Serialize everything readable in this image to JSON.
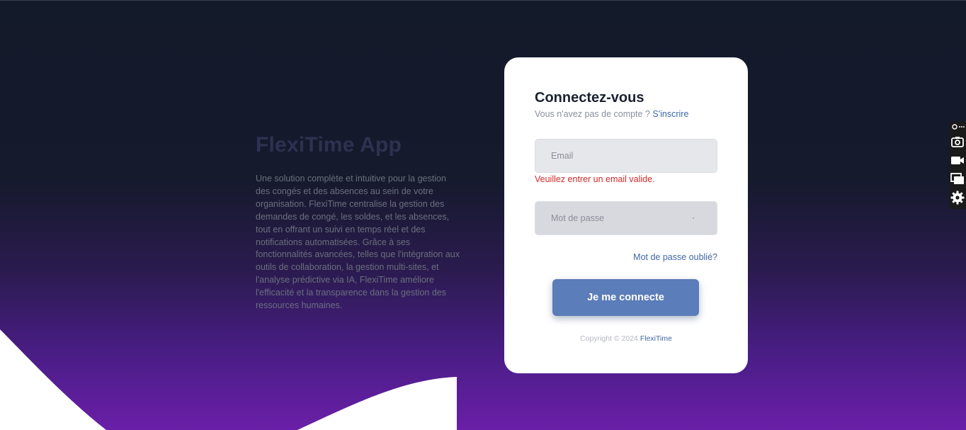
{
  "hero": {
    "title": "FlexiTime App",
    "description": "Une solution complète et intuitive pour la gestion des congés et des absences au sein de votre organisation. FlexiTime centralise la gestion des demandes de congé, les soldes, et les absences, tout en offrant un suivi en temps réel et des notifications automatisées. Grâce à ses fonctionnalités avancées, telles que l'intégration aux outils de collaboration, la gestion multi-sites, et l'analyse prédictive via IA, FlexiTime améliore l'efficacité et la transparence dans la gestion des ressources humaines."
  },
  "login": {
    "title": "Connectez-vous",
    "no_account_text": "Vous n'avez pas de compte ? ",
    "signup_link": "S'inscrire",
    "email_placeholder": "Email",
    "email_value": "",
    "email_error": "Veuillez entrer un email valide.",
    "password_placeholder": "Mot de passe",
    "password_value": "",
    "forgot_link": "Mot de passe oublié?",
    "submit_label": "Je me connecte",
    "copyright_text": "Copyright © 2024 ",
    "copyright_brand": "FlexiTime"
  },
  "dock": {
    "icons": [
      "link-icon",
      "more-icon",
      "camera-icon",
      "video-icon",
      "screens-icon",
      "gear-icon"
    ]
  },
  "colors": {
    "accent": "#5b7db9",
    "link": "#3f67a6",
    "error": "#d12a2a",
    "background_top": "#131a2a",
    "background_bottom": "#6a1fa8"
  }
}
